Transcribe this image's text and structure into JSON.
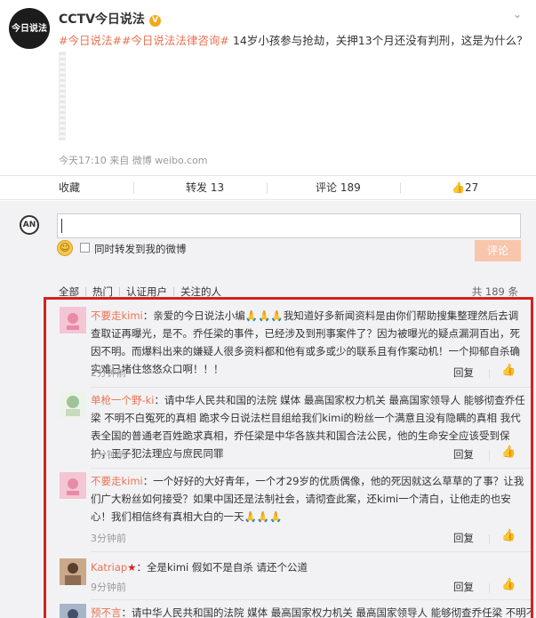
{
  "post": {
    "author": "CCTV今日说法",
    "verified_badge": "V",
    "avatar_text": "今日说法",
    "tags": [
      "#今日说法#",
      "#今日说法法律咨询#"
    ],
    "text": "14岁小孩参与抢劫，关押13个月还没有判刑，这是为什么？",
    "meta": "今天17:10 来自 微博 weibo.com"
  },
  "actions": {
    "favorite": "收藏",
    "repost": "转发 13",
    "comment": "评论 189",
    "like": "27"
  },
  "composer": {
    "forward_label": "同时转发到我的微博",
    "submit_label": "评论"
  },
  "filter": {
    "tabs": [
      "全部",
      "热门",
      "认证用户",
      "关注的人"
    ],
    "count": "共 189 条"
  },
  "comments": [
    {
      "user": "不要走kimi",
      "text": "：亲爱的今日说法小编🙏🙏🙏我知道好多新闻资料是由你们帮助搜集整理然后去调查取证再曝光，是不。乔任梁的事件，已经涉及到刑事案件了？因为被曝光的疑点漏洞百出，死因不明。而爆料出来的嫌疑人很多资料都和他有或多或少的联系且有作案动机！一个抑郁自杀确实难已堵住悠悠众口啊！！！",
      "time": "2分钟前",
      "reply": "回复"
    },
    {
      "user": "单枪一个野-ki",
      "text": "：请中华人民共和国的法院 媒体 最高国家权力机关 最高国家领导人 能够彻查乔任梁 不明不白冤死的真相 跪求今日说法栏目组给我们kimi的粉丝一个满意且没有隐瞒的真相 我代表全国的普通老百姓跪求真相，乔任梁是中华各族共和国合法公民，他的生命安全应该受到保护，王子犯法理应与庶民同罪",
      "time": "3分钟前",
      "reply": "回复"
    },
    {
      "user": "不要走kimi",
      "text": "：一个好好的大好青年，一个才29岁的优质偶像，他的死因就这么草草的了事？让我们广大粉丝如何接受？如果中国还是法制社会，请彻查此案，还kimi一个清白，让他走的也安心！我们相信终有真相大白的一天🙏🙏🙏",
      "time": "3分钟前",
      "reply": "回复"
    },
    {
      "user": "Katriap",
      "text": "：全是kimi 假如不是自杀 请还个公道",
      "time": "9分钟前",
      "reply": "回复"
    },
    {
      "user": "预不言",
      "text": "：请中华人民共和国的法院 媒体 最高国家权力机关 最高国家领导人 能够彻查乔任梁 不明不白冤死",
      "time": "",
      "reply": ""
    }
  ],
  "icons": {
    "more": "chevron-down-icon",
    "like": "thumbs-up-icon",
    "emoji": "smiley-icon"
  },
  "colors": {
    "link": "#eb7350",
    "frame": "#d6221f",
    "submit_bg": "#f8c6ad"
  }
}
